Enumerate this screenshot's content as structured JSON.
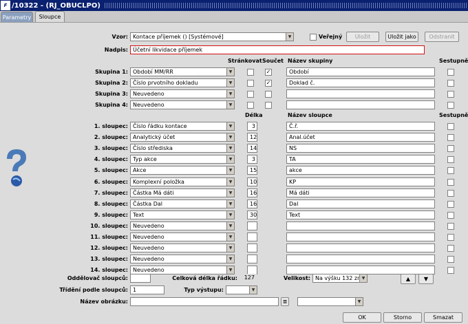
{
  "title": "/10322 - (RJ_OBUCLPO)",
  "tabs": [
    "Parametry",
    "Sloupce"
  ],
  "vzor": {
    "label": "Vzor:",
    "value": "Kontace příjemek   ()   [Systémové]"
  },
  "verejny_label": "Veřejný",
  "buttons": {
    "ulozit": "Uložit",
    "ulozit_jako": "Uložit jako",
    "odstranit": "Odstranit",
    "ok": "OK",
    "storno": "Storno",
    "smazat": "Smazat"
  },
  "nadpis": {
    "label": "Nadpis:",
    "value": "Účetní likvidace příjemek"
  },
  "group_headers": {
    "strankovat": "Stránkovat",
    "soucet": "Součet",
    "nazev_skupiny": "Název skupiny",
    "sestupne": "Sestupně"
  },
  "groups": [
    {
      "label": "Skupina 1:",
      "value": "Období MM/RR",
      "strankovat": false,
      "soucet": true,
      "name": "Období",
      "sestupne": false
    },
    {
      "label": "Skupina 2:",
      "value": "Číslo prvotního dokladu",
      "strankovat": false,
      "soucet": true,
      "name": "Doklad č.",
      "sestupne": false
    },
    {
      "label": "Skupina 3:",
      "value": "Neuvedeno",
      "strankovat": false,
      "soucet": false,
      "name": "",
      "sestupne": false
    },
    {
      "label": "Skupina 4:",
      "value": "Neuvedeno",
      "strankovat": false,
      "soucet": false,
      "name": "",
      "sestupne": false
    }
  ],
  "column_headers": {
    "delka": "Délka",
    "nazev_sloupce": "Název sloupce",
    "sestupne": "Sestupně"
  },
  "columns": [
    {
      "label": "1. sloupec:",
      "value": "Číslo řádku kontace",
      "delka": "3",
      "name": "Č.ř."
    },
    {
      "label": "2. sloupec:",
      "value": "Analytický účet",
      "delka": "12",
      "name": "Anal.účet"
    },
    {
      "label": "3. sloupec:",
      "value": "Číslo střediska",
      "delka": "14",
      "name": "NS"
    },
    {
      "label": "4. sloupec:",
      "value": "Typ akce",
      "delka": "3",
      "name": "TA"
    },
    {
      "label": "5. sloupec:",
      "value": "Akce",
      "delka": "15",
      "name": "akce"
    },
    {
      "label": "6. sloupec:",
      "value": "Komplexní položka",
      "delka": "10",
      "name": "KP"
    },
    {
      "label": "7. sloupec:",
      "value": "Částka Má dáti",
      "delka": "16",
      "name": "Má dáti"
    },
    {
      "label": "8. sloupec:",
      "value": "Částka Dal",
      "delka": "16",
      "name": "Dal"
    },
    {
      "label": "9. sloupec:",
      "value": "Text",
      "delka": "30",
      "name": "Text"
    },
    {
      "label": "10. sloupec:",
      "value": "Neuvedeno",
      "delka": "",
      "name": ""
    },
    {
      "label": "11. sloupec:",
      "value": "Neuvedeno",
      "delka": "",
      "name": ""
    },
    {
      "label": "12. sloupec:",
      "value": "Neuvedeno",
      "delka": "",
      "name": ""
    },
    {
      "label": "13. sloupec:",
      "value": "Neuvedeno",
      "delka": "",
      "name": ""
    },
    {
      "label": "14. sloupec:",
      "value": "Neuvedeno",
      "delka": "",
      "name": ""
    }
  ],
  "oddelovac": {
    "label": "Oddělovač sloupců:",
    "value": ""
  },
  "celkova": {
    "label": "Celková délka řádku:",
    "value": "127"
  },
  "velikost": {
    "label": "Velikost:",
    "value": "Na výšku 132 zn."
  },
  "trideni": {
    "label": "Třídění podle sloupců:",
    "value": "1"
  },
  "typ_vystupu": {
    "label": "Typ výstupu:",
    "value": ""
  },
  "nazev_obrazku": {
    "label": "Název obrázku:",
    "value": "",
    "select": ""
  },
  "icons": [
    "app-icon",
    "help-icon",
    "dropdown-arrow-icon",
    "up-arrow-icon",
    "down-arrow-icon",
    "list-icon"
  ]
}
